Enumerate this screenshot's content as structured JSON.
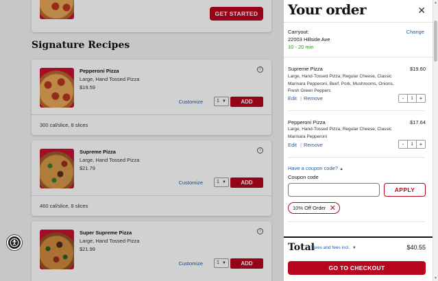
{
  "menu": {
    "get_started_label": "GET STARTED",
    "section_title": "Signature Recipes",
    "items": [
      {
        "name": "Pepperoni Pizza",
        "description": "Large, Hand Tossed Pizza",
        "price": "$19.59",
        "customize_label": "Customize",
        "qty": "1",
        "add_label": "ADD",
        "calories": "300 cal/slice, 8 slices"
      },
      {
        "name": "Supreme Pizza",
        "description": "Large, Hand Tossed Pizza",
        "price": "$21.79",
        "customize_label": "Customize",
        "qty": "1",
        "add_label": "ADD",
        "calories": "460 cal/slice, 8 slices"
      },
      {
        "name": "Super Supreme Pizza",
        "description": "Large, Hand Tossed Pizza",
        "price": "$21.99",
        "customize_label": "Customize",
        "qty": "1",
        "add_label": "ADD"
      }
    ]
  },
  "cart": {
    "title": "Your order",
    "carryout_label": "Carryout:",
    "change_label": "Change",
    "address": "22003 Hillside Ave",
    "eta": "10 - 20 min",
    "lines": [
      {
        "name": "Supreme Pizza",
        "price": "$19.60",
        "details": "Large, Hand-Tossed Pizza, Regular Cheese, Classic Marinara Pepperoni, Beef, Pork, Mushrooms, Onions, Fresh Green Peppers",
        "edit_label": "Edit",
        "remove_label": "Remove",
        "qty": "1"
      },
      {
        "name": "Pepperoni Pizza",
        "price": "$17.64",
        "details": "Large, Hand-Tossed Pizza, Regular Cheese, Classic Marinara Pepperoni",
        "edit_label": "Edit",
        "remove_label": "Remove",
        "qty": "1"
      }
    ],
    "coupon_toggle_label": "Have a coupon code?",
    "coupon_code_label": "Coupon code",
    "coupon_input_value": "",
    "apply_label": "APPLY",
    "applied_coupon": "10% Off Order",
    "total_label": "Total",
    "taxes_label": "Taxes and fees incl.",
    "total_value": "$40.55",
    "checkout_label": "GO TO CHECKOUT"
  },
  "colors": {
    "brand_red": "#b8061f",
    "link_blue": "#1f5aa6",
    "eta_green": "#2e8b1e"
  }
}
